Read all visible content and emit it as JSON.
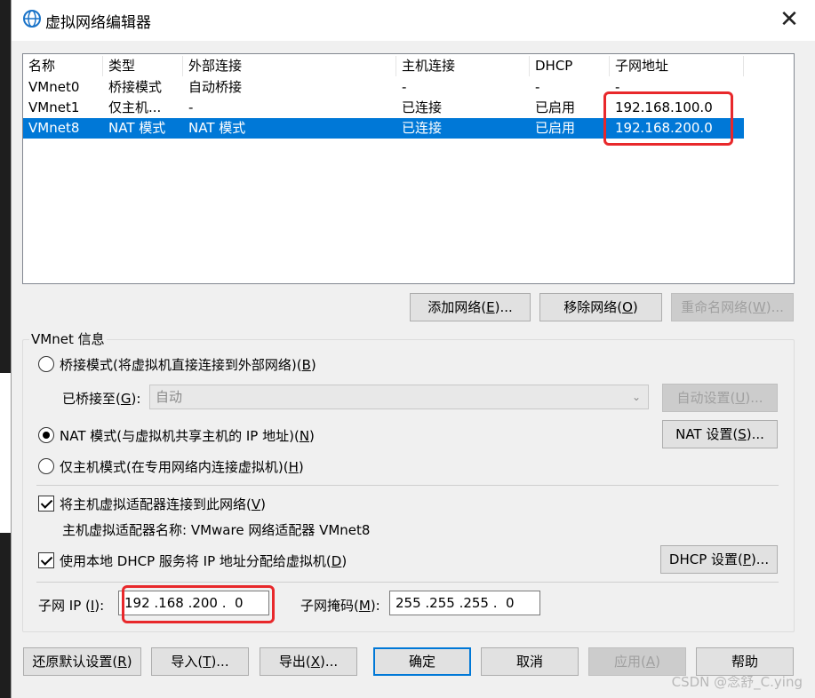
{
  "window": {
    "title": "虚拟网络编辑器",
    "close_glyph": "✕"
  },
  "network_list": {
    "columns": [
      "名称",
      "类型",
      "外部连接",
      "主机连接",
      "DHCP",
      "子网地址"
    ],
    "rows": [
      {
        "name": "VMnet0",
        "type": "桥接模式",
        "external": "自动桥接",
        "host": "-",
        "dhcp": "-",
        "subnet": "-",
        "selected": false
      },
      {
        "name": "VMnet1",
        "type": "仅主机...",
        "external": "-",
        "host": "已连接",
        "dhcp": "已启用",
        "subnet": "192.168.100.0",
        "selected": false
      },
      {
        "name": "VMnet8",
        "type": "NAT 模式",
        "external": "NAT 模式",
        "host": "已连接",
        "dhcp": "已启用",
        "subnet": "192.168.200.0",
        "selected": true
      }
    ]
  },
  "list_buttons": {
    "add": {
      "text": "添加网络(",
      "key": "E",
      "tail": ")..."
    },
    "remove": {
      "text": "移除网络(",
      "key": "O",
      "tail": ")"
    },
    "rename": {
      "text": "重命名网络(",
      "key": "W",
      "tail": ")..."
    }
  },
  "vmnet_info": {
    "title": "VMnet 信息",
    "bridge_mode": {
      "text": "桥接模式(将虚拟机直接连接到外部网络)(",
      "key": "B",
      "tail": ")",
      "selected": false
    },
    "bridged_to": {
      "text": "已桥接至(",
      "key": "G",
      "tail": "):",
      "value": "自动"
    },
    "auto_settings": {
      "text": "自动设置(",
      "key": "U",
      "tail": ")..."
    },
    "nat_mode": {
      "text": "NAT 模式(与虚拟机共享主机的 IP 地址)(",
      "key": "N",
      "tail": ")",
      "selected": true
    },
    "nat_settings": {
      "text": "NAT 设置(",
      "key": "S",
      "tail": ")..."
    },
    "host_only": {
      "text": "仅主机模式(在专用网络内连接虚拟机)(",
      "key": "H",
      "tail": ")",
      "selected": false
    },
    "connect_adapter": {
      "text": "将主机虚拟适配器连接到此网络(",
      "key": "V",
      "tail": ")",
      "checked": true
    },
    "adapter_name": "主机虚拟适配器名称: VMware 网络适配器 VMnet8",
    "use_dhcp": {
      "text": "使用本地 DHCP 服务将 IP 地址分配给虚拟机(",
      "key": "D",
      "tail": ")",
      "checked": true
    },
    "dhcp_settings": {
      "text": "DHCP 设置(",
      "key": "P",
      "tail": ")..."
    },
    "subnet_ip": {
      "text": "子网 IP (",
      "key": "I",
      "tail": "):",
      "value": "192 .168 .200 .  0"
    },
    "subnet_mask": {
      "text": "子网掩码(",
      "key": "M",
      "tail": "):",
      "value": "255 .255 .255 .  0"
    }
  },
  "footer_buttons": {
    "restore": {
      "text": "还原默认设置(",
      "key": "R",
      "tail": ")"
    },
    "import": {
      "text": "导入(",
      "key": "T",
      "tail": ")..."
    },
    "export": {
      "text": "导出(",
      "key": "X",
      "tail": ")..."
    },
    "ok": "确定",
    "cancel": "取消",
    "apply": {
      "text": "应用(",
      "key": "A",
      "tail": ")"
    },
    "help": "帮助"
  },
  "watermark": "CSDN @念舒_C.ying",
  "colors": {
    "selection": "#0078d7",
    "highlight_box": "#e8282b"
  }
}
